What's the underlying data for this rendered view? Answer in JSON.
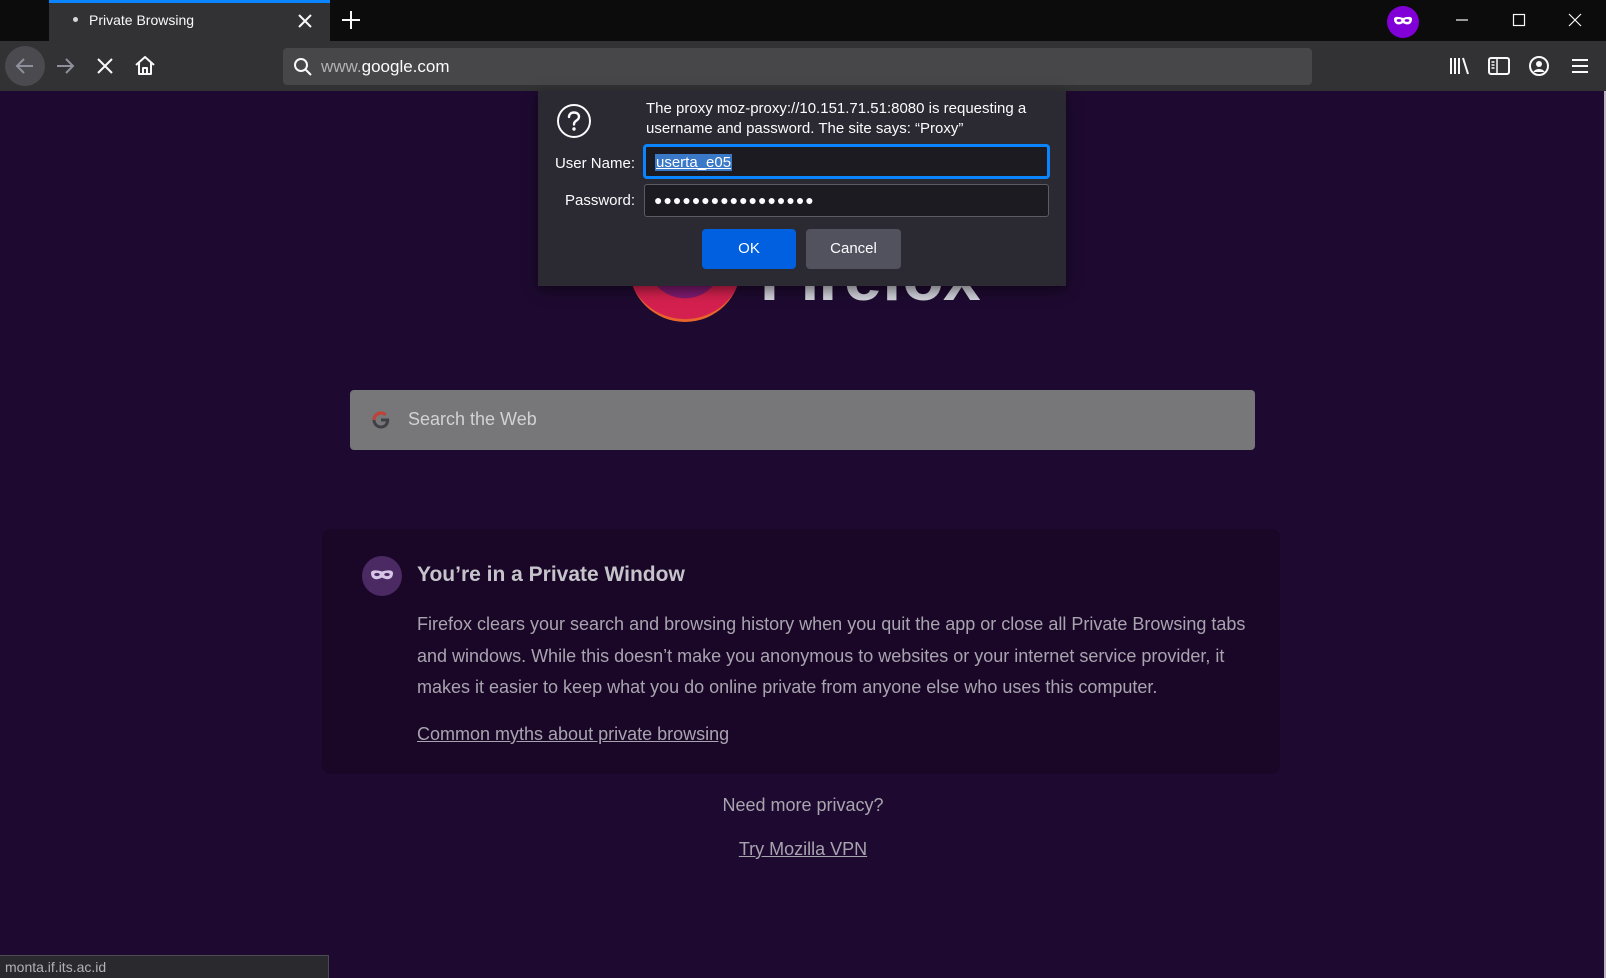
{
  "tab": {
    "title": "Private Browsing"
  },
  "navbar": {
    "url_prefix": "www.",
    "url_domain": "google.com"
  },
  "newtab": {
    "logo_wordmark": "Firefox",
    "search_placeholder": "Search the Web",
    "private_card": {
      "title": "You’re in a Private Window",
      "body": "Firefox clears your search and browsing history when you quit the app or close all Private Browsing tabs and windows. While this doesn’t make you anonymous to websites or your internet service provider, it makes it easier to keep what you do online private from anyone else who uses this computer.",
      "link": "Common myths about private browsing"
    },
    "more_privacy": "Need more privacy?",
    "vpn_link": "Try Mozilla VPN"
  },
  "status_bar": {
    "text": "monta.if.its.ac.id"
  },
  "auth_dialog": {
    "message": "The proxy moz-proxy://10.151.71.51:8080 is requesting a username and password. The site says: “Proxy”",
    "username_label": "User Name:",
    "username_value": "userta_e05",
    "password_label": "Password:",
    "password_mask": "●●●●●●●●●●●●●●●●●",
    "ok_label": "OK",
    "cancel_label": "Cancel"
  },
  "colors": {
    "accent": "#0a84ff",
    "ok_button": "#0060df",
    "private_purple": "#8000d7",
    "page_background": "#1e0a30"
  },
  "icons": [
    "tab-dot-icon",
    "close-icon",
    "plus-icon",
    "private-mask-icon",
    "minimize-icon",
    "maximize-icon",
    "back-icon",
    "forward-icon",
    "stop-icon",
    "home-icon",
    "search-icon",
    "library-icon",
    "sidebar-icon",
    "account-icon",
    "menu-icon",
    "question-icon",
    "google-icon"
  ]
}
